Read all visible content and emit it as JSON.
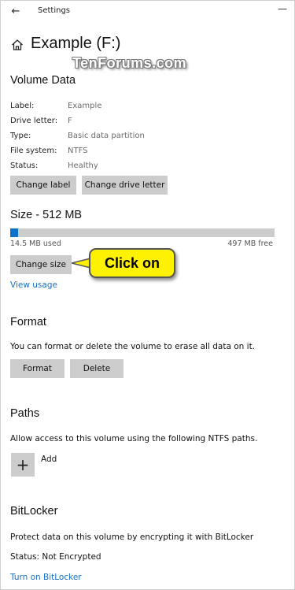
{
  "titlebar": {
    "title": "Settings",
    "back_glyph": "←",
    "minimize_glyph": "—"
  },
  "header": {
    "icon": "home-icon",
    "title": "Example (F:)",
    "watermark": "TenForums.com"
  },
  "volume_data": {
    "heading": "Volume Data",
    "fields": [
      {
        "key": "Label:",
        "value": "Example"
      },
      {
        "key": "Drive letter:",
        "value": "F"
      },
      {
        "key": "Type:",
        "value": "Basic data partition"
      },
      {
        "key": "File system:",
        "value": "NTFS"
      },
      {
        "key": "Status:",
        "value": "Healthy"
      }
    ],
    "change_label_button": "Change label",
    "change_drive_letter_button": "Change drive letter"
  },
  "size": {
    "heading": "Size - 512 MB",
    "used_text": "14.5 MB used",
    "free_text": "497 MB free",
    "used_fraction": 0.0283,
    "change_size_button": "Change size",
    "callout_text": "Click on",
    "view_usage_link": "View usage"
  },
  "format": {
    "heading": "Format",
    "description": "You can format or delete the volume to erase all data on it.",
    "format_button": "Format",
    "delete_button": "Delete"
  },
  "paths": {
    "heading": "Paths",
    "description": "Allow access to this volume using the following NTFS paths.",
    "add_glyph": "+",
    "add_label": "Add"
  },
  "bitlocker": {
    "heading": "BitLocker",
    "description": "Protect data on this volume by encrypting it with BitLocker",
    "status": "Status: Not Encrypted",
    "turn_on_link": "Turn on BitLocker"
  },
  "colors": {
    "accent": "#0a72c9",
    "link": "#1a6fc4",
    "callout": "#fff200",
    "button": "#cccccc"
  }
}
